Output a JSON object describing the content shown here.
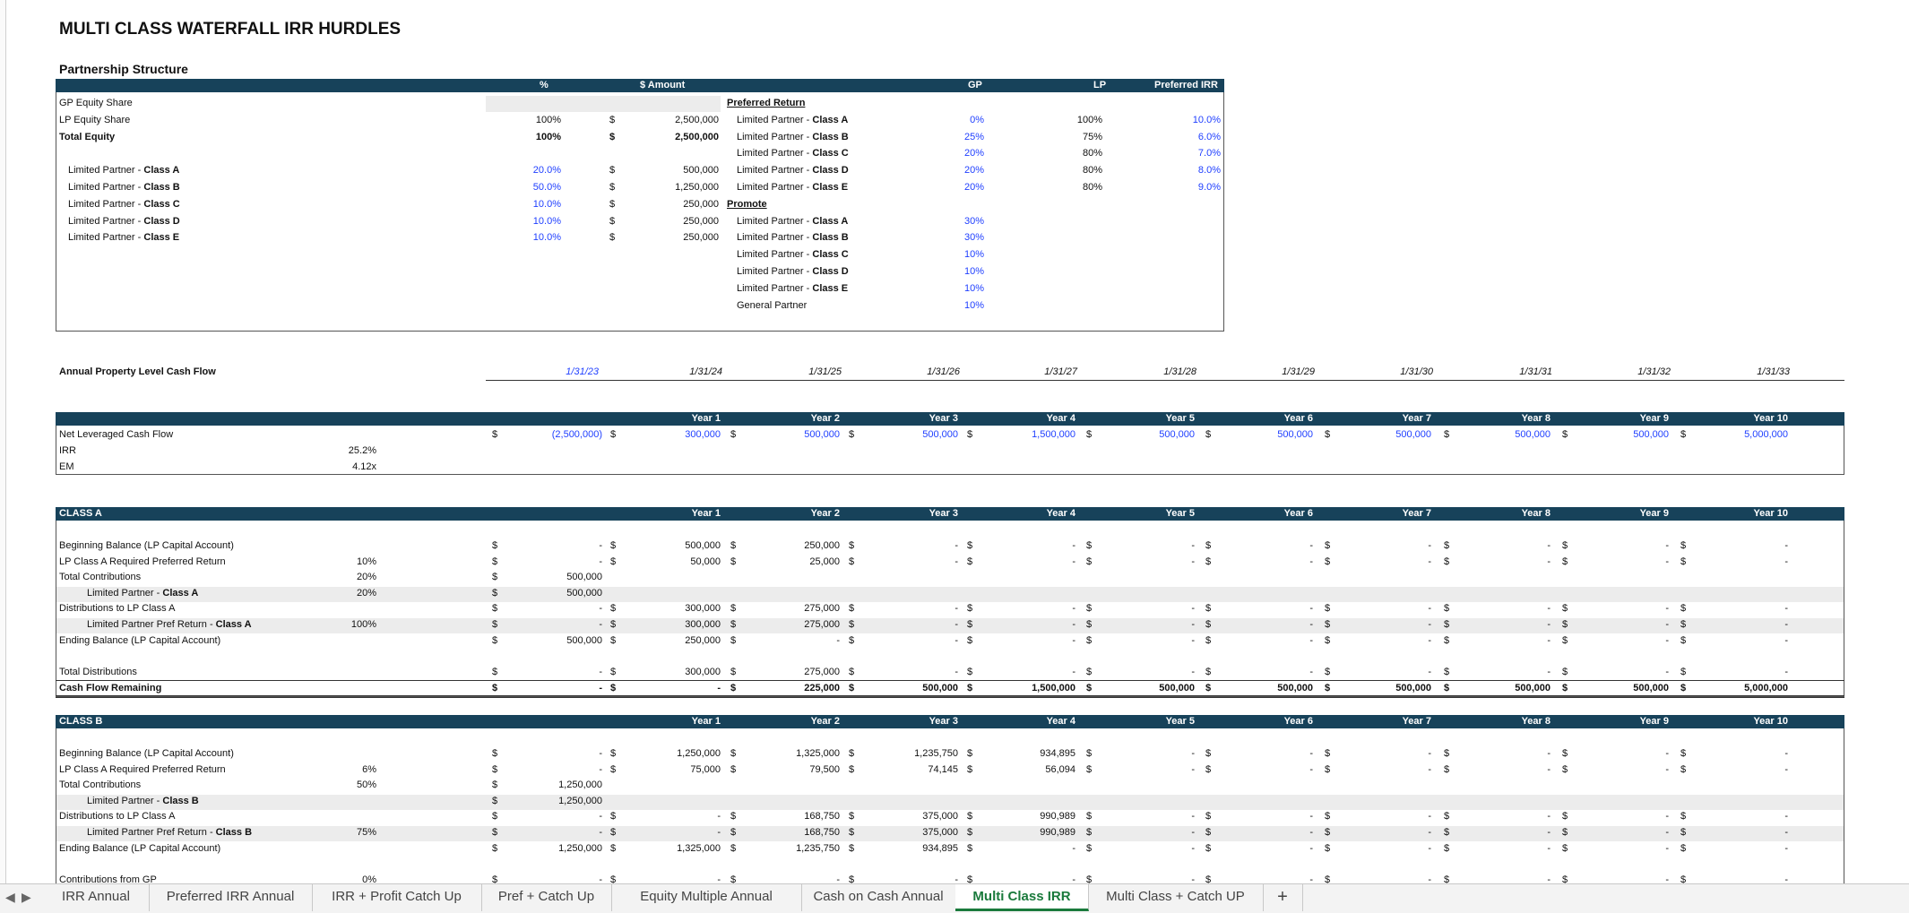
{
  "title": "MULTI CLASS WATERFALL IRR HURDLES",
  "partnership": {
    "heading": "Partnership Structure",
    "headers": {
      "pct": "%",
      "amount": "$ Amount",
      "gp": "GP",
      "lp": "LP",
      "pref_irr": "Preferred IRR"
    },
    "gp_share": "GP Equity Share",
    "lp_share": {
      "label": "LP Equity Share",
      "pct": "100%",
      "dollar": "$",
      "amount": "2,500,000"
    },
    "total": {
      "label": "Total Equity",
      "pct": "100%",
      "dollar": "$",
      "amount": "2,500,000"
    },
    "classes": [
      {
        "prefix": "Limited Partner - ",
        "cls": "Class A",
        "pct": "20.0%",
        "dollar": "$",
        "amount": "500,000"
      },
      {
        "prefix": "Limited Partner - ",
        "cls": "Class B",
        "pct": "50.0%",
        "dollar": "$",
        "amount": "1,250,000"
      },
      {
        "prefix": "Limited Partner - ",
        "cls": "Class C",
        "pct": "10.0%",
        "dollar": "$",
        "amount": "250,000"
      },
      {
        "prefix": "Limited Partner - ",
        "cls": "Class D",
        "pct": "10.0%",
        "dollar": "$",
        "amount": "250,000"
      },
      {
        "prefix": "Limited Partner - ",
        "cls": "Class E",
        "pct": "10.0%",
        "dollar": "$",
        "amount": "250,000"
      }
    ],
    "pref_heading": "Preferred Return",
    "pref_rows": [
      {
        "prefix": "Limited Partner - ",
        "cls": "Class A",
        "gp": "0%",
        "lp": "100%",
        "irr": "10.0%"
      },
      {
        "prefix": "Limited Partner - ",
        "cls": "Class B",
        "gp": "25%",
        "lp": "75%",
        "irr": "6.0%"
      },
      {
        "prefix": "Limited Partner - ",
        "cls": "Class C",
        "gp": "20%",
        "lp": "80%",
        "irr": "7.0%"
      },
      {
        "prefix": "Limited Partner - ",
        "cls": "Class D",
        "gp": "20%",
        "lp": "80%",
        "irr": "8.0%"
      },
      {
        "prefix": "Limited Partner - ",
        "cls": "Class E",
        "gp": "20%",
        "lp": "80%",
        "irr": "9.0%"
      }
    ],
    "promote_heading": "Promote",
    "promote_rows": [
      {
        "prefix": "Limited Partner - ",
        "cls": "Class A",
        "gp": "30%"
      },
      {
        "prefix": "Limited Partner - ",
        "cls": "Class B",
        "gp": "30%"
      },
      {
        "prefix": "Limited Partner - ",
        "cls": "Class C",
        "gp": "10%"
      },
      {
        "prefix": "Limited Partner - ",
        "cls": "Class D",
        "gp": "10%"
      },
      {
        "prefix": "Limited Partner - ",
        "cls": "Class E",
        "gp": "10%"
      },
      {
        "prefix": "General Partner",
        "cls": "",
        "gp": "10%"
      }
    ]
  },
  "annual": {
    "label": "Annual Property Level Cash Flow",
    "dates": [
      "1/31/23",
      "1/31/24",
      "1/31/25",
      "1/31/26",
      "1/31/27",
      "1/31/28",
      "1/31/29",
      "1/31/30",
      "1/31/31",
      "1/31/32",
      "1/31/33"
    ]
  },
  "years": [
    "Year 1",
    "Year 2",
    "Year 3",
    "Year 4",
    "Year 5",
    "Year 6",
    "Year 7",
    "Year 8",
    "Year 9",
    "Year 10"
  ],
  "dollar": "$",
  "summary": {
    "net_label": "Net Leveraged Cash Flow",
    "net_values": [
      "(2,500,000)",
      "300,000",
      "500,000",
      "500,000",
      "1,500,000",
      "500,000",
      "500,000",
      "500,000",
      "500,000",
      "500,000",
      "5,000,000"
    ],
    "irr_label": "IRR",
    "irr": "25.2%",
    "em_label": "EM",
    "em": "4.12x"
  },
  "classA": {
    "heading": "CLASS A",
    "rows": [
      {
        "label": "Beginning Balance (LP Capital Account)",
        "mid": "",
        "values": [
          "-",
          "500,000",
          "250,000",
          "-",
          "-",
          "-",
          "-",
          "-",
          "-",
          "-",
          "-"
        ]
      },
      {
        "label": "LP Class A Required Preferred Return",
        "mid": "10%",
        "values": [
          "-",
          "50,000",
          "25,000",
          "-",
          "-",
          "-",
          "-",
          "-",
          "-",
          "-",
          "-"
        ]
      },
      {
        "label": "Total Contributions",
        "mid": "20%",
        "values": [
          "500,000"
        ]
      },
      {
        "label": "Limited Partner - ",
        "cls": "Class A",
        "indent": true,
        "shade": true,
        "mid": "20%",
        "values": [
          "500,000"
        ]
      },
      {
        "label": "Distributions to LP Class A",
        "mid": "",
        "values": [
          "-",
          "300,000",
          "275,000",
          "-",
          "-",
          "-",
          "-",
          "-",
          "-",
          "-",
          "-"
        ]
      },
      {
        "label": "Limited Partner Pref Return - ",
        "cls": "Class A",
        "indent": true,
        "shade": true,
        "mid": "100%",
        "values": [
          "-",
          "300,000",
          "275,000",
          "-",
          "-",
          "-",
          "-",
          "-",
          "-",
          "-",
          "-"
        ]
      },
      {
        "label": "Ending Balance (LP Capital Account)",
        "mid": "",
        "values": [
          "500,000",
          "250,000",
          "-",
          "-",
          "-",
          "-",
          "-",
          "-",
          "-",
          "-",
          "-"
        ]
      }
    ],
    "total_dist": {
      "label": "Total Distributions",
      "values": [
        "-",
        "300,000",
        "275,000",
        "-",
        "-",
        "-",
        "-",
        "-",
        "-",
        "-",
        "-"
      ]
    },
    "remaining": {
      "label": "Cash Flow Remaining",
      "values": [
        "-",
        "-",
        "225,000",
        "500,000",
        "1,500,000",
        "500,000",
        "500,000",
        "500,000",
        "500,000",
        "500,000",
        "5,000,000"
      ]
    }
  },
  "classB": {
    "heading": "CLASS B",
    "rows": [
      {
        "label": "Beginning Balance (LP Capital Account)",
        "mid": "",
        "values": [
          "-",
          "1,250,000",
          "1,325,000",
          "1,235,750",
          "934,895",
          "-",
          "-",
          "-",
          "-",
          "-",
          "-"
        ]
      },
      {
        "label": "LP Class A Required Preferred Return",
        "mid": "6%",
        "values": [
          "-",
          "75,000",
          "79,500",
          "74,145",
          "56,094",
          "-",
          "-",
          "-",
          "-",
          "-",
          "-"
        ]
      },
      {
        "label": "Total Contributions",
        "mid": "50%",
        "values": [
          "1,250,000"
        ]
      },
      {
        "label": "Limited Partner - ",
        "cls": "Class B",
        "indent": true,
        "shade": true,
        "mid": "",
        "values": [
          "1,250,000"
        ]
      },
      {
        "label": "Distributions to LP Class A",
        "mid": "",
        "values": [
          "-",
          "-",
          "168,750",
          "375,000",
          "990,989",
          "-",
          "-",
          "-",
          "-",
          "-",
          "-"
        ]
      },
      {
        "label": "Limited Partner Pref Return - ",
        "cls": "Class B",
        "indent": true,
        "shade": true,
        "mid": "75%",
        "values": [
          "-",
          "-",
          "168,750",
          "375,000",
          "990,989",
          "-",
          "-",
          "-",
          "-",
          "-",
          "-"
        ]
      },
      {
        "label": "Ending Balance (LP Capital Account)",
        "mid": "",
        "values": [
          "1,250,000",
          "1,325,000",
          "1,235,750",
          "934,895",
          "-",
          "-",
          "-",
          "-",
          "-",
          "-",
          "-"
        ]
      }
    ],
    "partial": {
      "label": "Contributions from GP",
      "mid": "0%"
    }
  },
  "tabs": [
    "IRR Annual",
    "Preferred IRR Annual",
    "IRR + Profit Catch Up",
    "Pref + Catch Up",
    "Equity Multiple Annual",
    "Cash on Cash Annual",
    "Multi Class IRR",
    "Multi Class + Catch UP"
  ],
  "active_tab": "Multi Class IRR",
  "add_tab": "+",
  "nav": {
    "prev": "◀",
    "next": "▶"
  }
}
